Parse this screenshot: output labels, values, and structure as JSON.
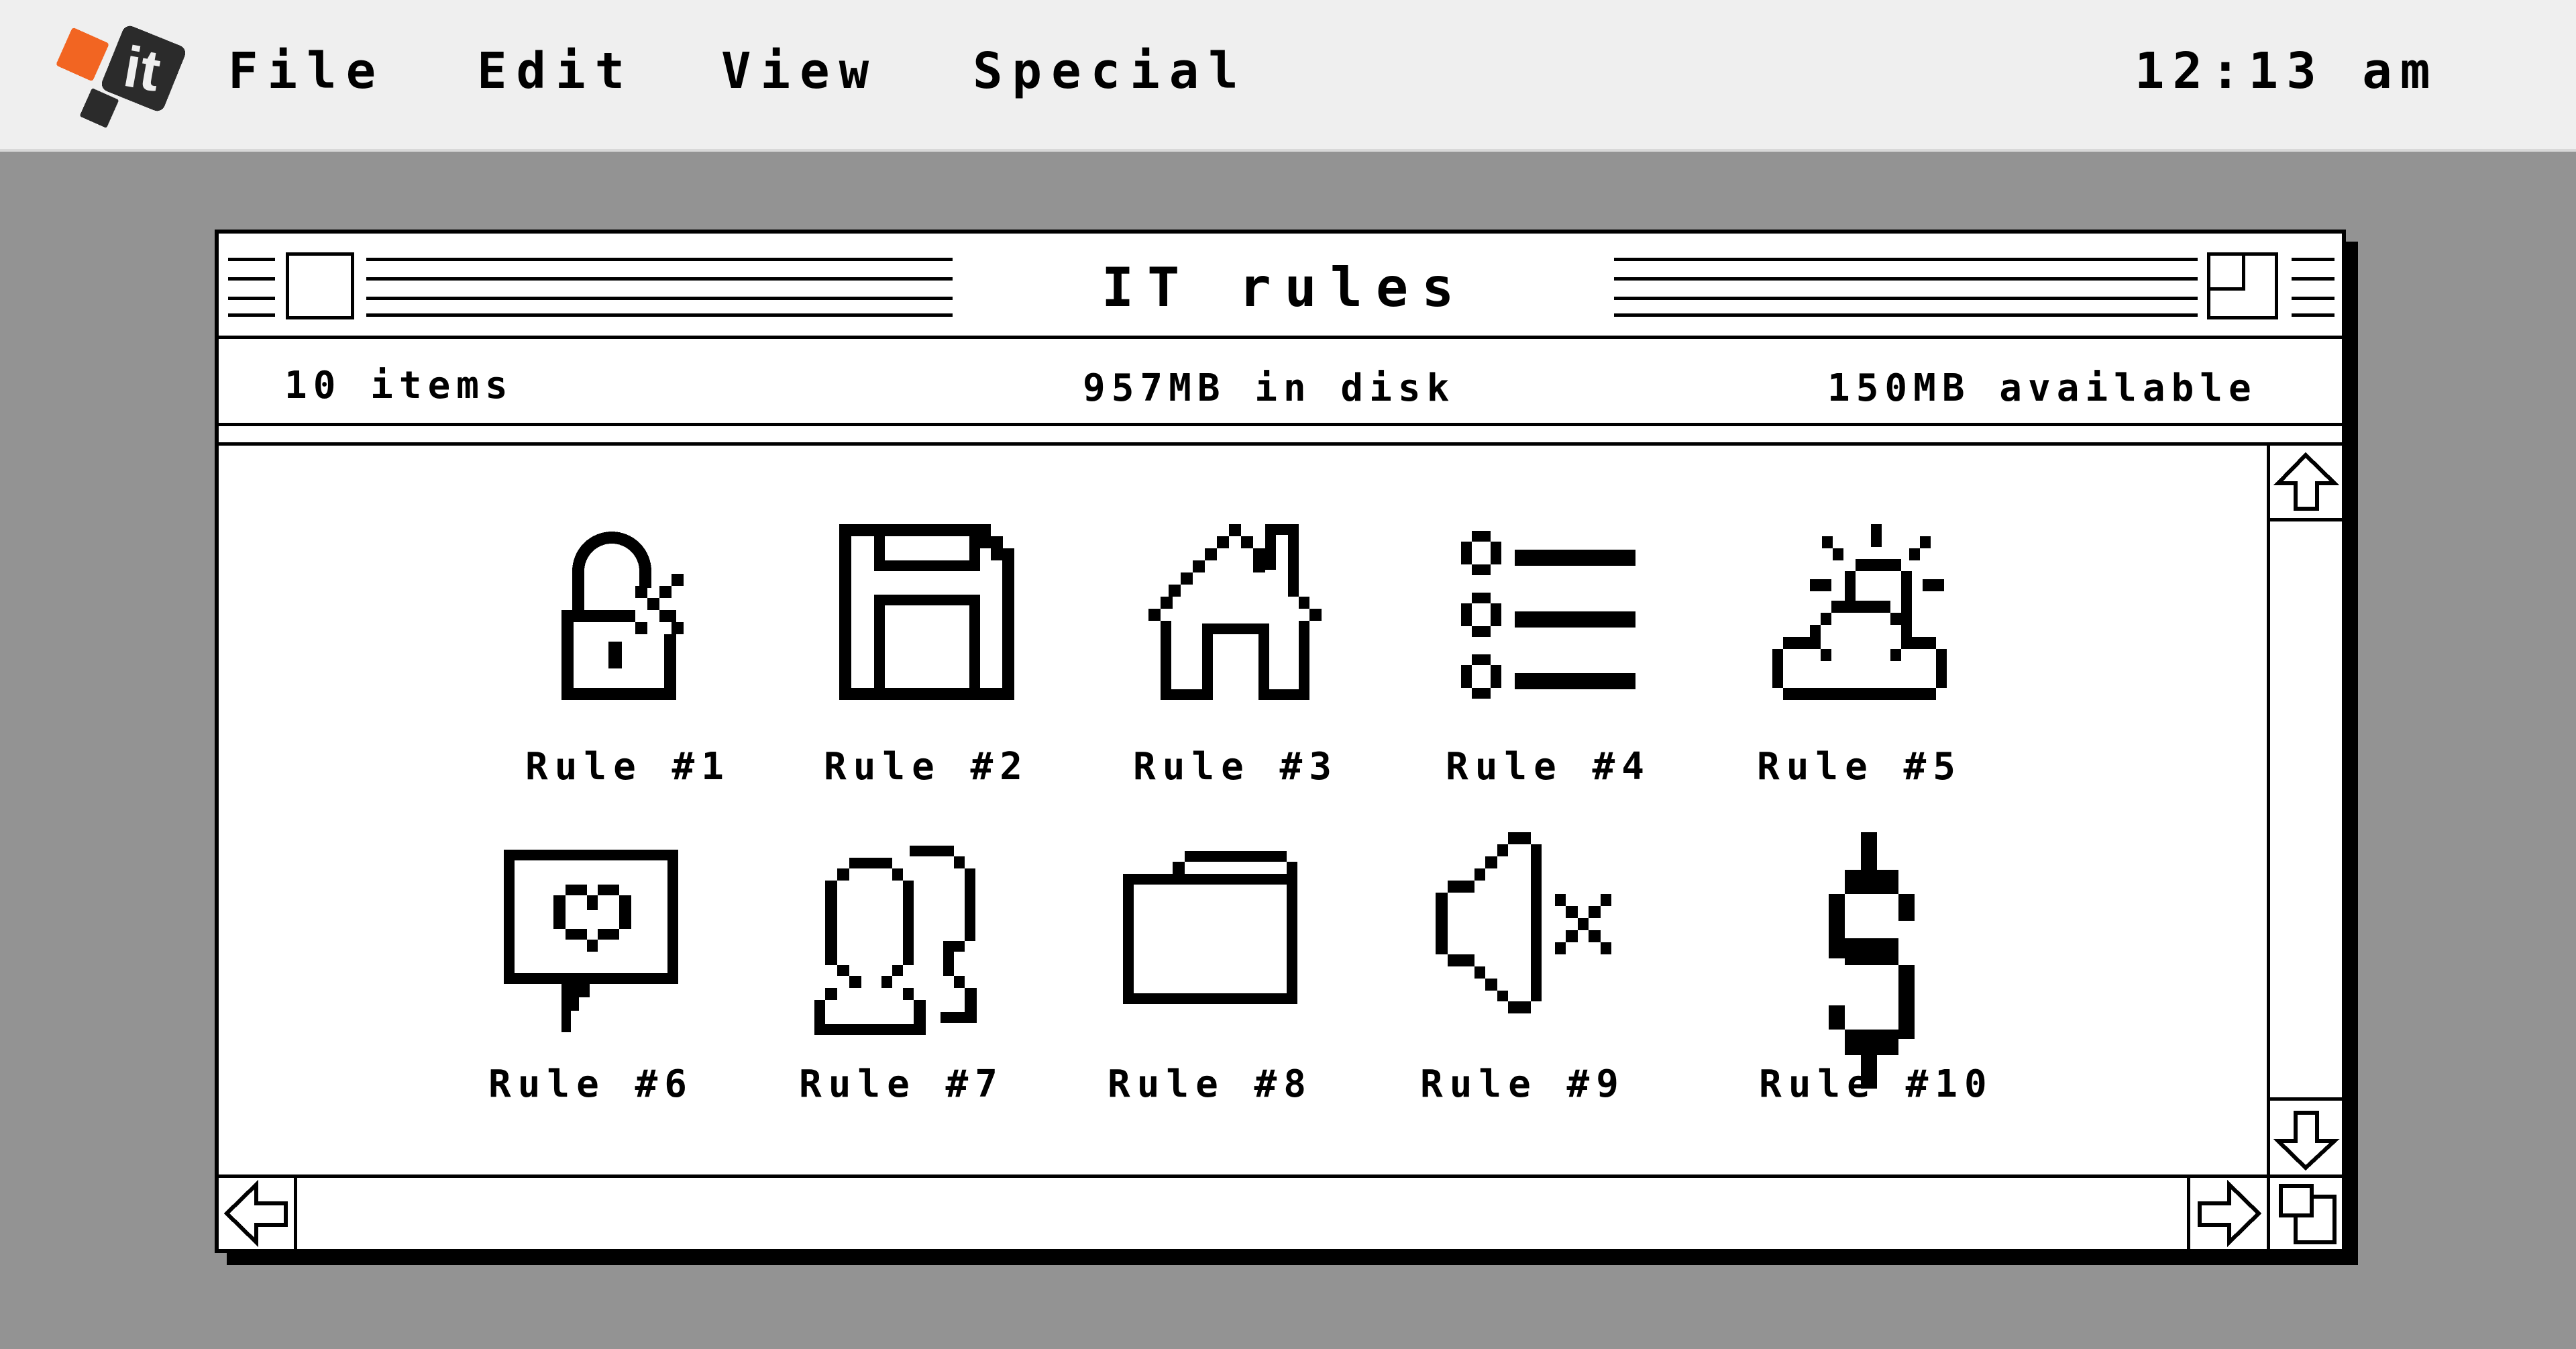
{
  "menubar": {
    "logo_text": "it",
    "items": [
      {
        "label": "File"
      },
      {
        "label": "Edit"
      },
      {
        "label": "View"
      },
      {
        "label": "Special"
      }
    ],
    "clock": "12:13 am"
  },
  "window": {
    "title": "IT rules",
    "info": {
      "items_count": "10 items",
      "disk_used": "957MB in disk",
      "available": "150MB available"
    },
    "icons": [
      {
        "label": "Rule #1",
        "icon": "unlocked-padlock-icon"
      },
      {
        "label": "Rule #2",
        "icon": "floppy-disk-icon"
      },
      {
        "label": "Rule #3",
        "icon": "home-icon"
      },
      {
        "label": "Rule #4",
        "icon": "list-icon"
      },
      {
        "label": "Rule #5",
        "icon": "partly-cloudy-icon"
      },
      {
        "label": "Rule #6",
        "icon": "heart-message-icon"
      },
      {
        "label": "Rule #7",
        "icon": "users-icon"
      },
      {
        "label": "Rule #8",
        "icon": "folder-icon"
      },
      {
        "label": "Rule #9",
        "icon": "mute-speaker-icon"
      },
      {
        "label": "Rule #10",
        "icon": "dollar-icon"
      }
    ]
  },
  "colors": {
    "desktop": "#939393",
    "menubar": "#efefef",
    "logo_orange": "#f26522",
    "logo_dark": "#2b2b2b",
    "ink": "#000000",
    "window": "#ffffff"
  }
}
